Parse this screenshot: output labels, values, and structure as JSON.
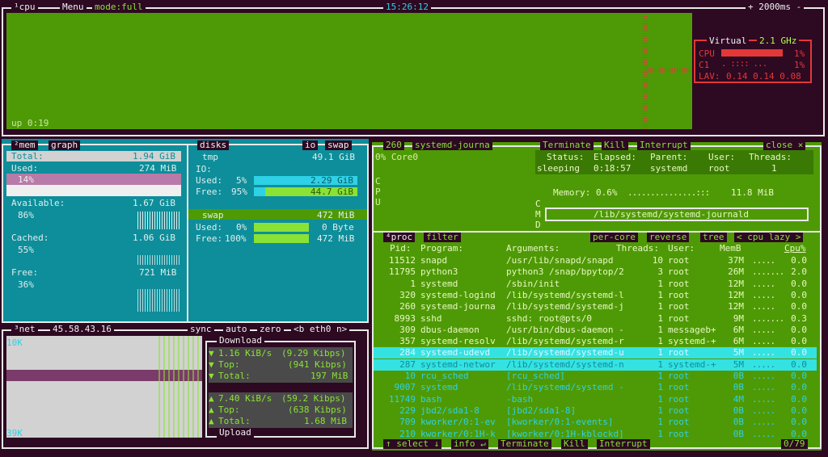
{
  "colors": {
    "bg": "#2d0922",
    "cpu_graph": "#4e9a06",
    "mem_panel": "#0e8e9a",
    "proc_panel": "#4e9a06",
    "selected_row": "#34e2e2",
    "accent": "#8ae234"
  },
  "cpu": {
    "tab": "¹cpu",
    "menu": "Menu",
    "mode": "mode:full",
    "clock": "15:26:12",
    "rate": "+ 2000ms -",
    "uptime": "up 0:19",
    "box_title": "Virtual",
    "freq": "2.1 GHz",
    "rows": [
      {
        "label": "CPU",
        "pct": "1%",
        "value": 0.01
      },
      {
        "label": "C1",
        "pct": "1%",
        "value": 0.01
      }
    ],
    "lav_label": "LAV:",
    "lav": "0.14 0.14 0.08"
  },
  "mem": {
    "tab": "²mem",
    "graph": "graph",
    "total_label": "Total:",
    "total": "1.94 GiB",
    "used_label": "Used:",
    "used": "274 MiB",
    "used_pct": "14%",
    "used_value": 0.14,
    "available_label": "Available:",
    "available": "1.67 GiB",
    "available_pct": "86%",
    "cached_label": "Cached:",
    "cached": "1.06 GiB",
    "cached_pct": "55%",
    "free_label": "Free:",
    "free": "721 MiB",
    "free_pct": "36%"
  },
  "disks": {
    "tab": "disks",
    "io": "io",
    "swap_tab": "swap",
    "tmp": {
      "name": "tmp",
      "size": "49.1 GiB",
      "io": "IO:",
      "used_label": "Used:",
      "used_pct": "5%",
      "used": "2.29 GiB",
      "used_value": 0.05,
      "free_label": "Free:",
      "free_pct": "95%",
      "free": "44.7 GiB",
      "free_value": 0.95
    },
    "swap": {
      "name": "swap",
      "size": "472 MiB",
      "used_label": "Used:",
      "used_pct": "0%",
      "used": "0 Byte",
      "used_value": 0.0,
      "free_label": "Free:",
      "free_pct": "100%",
      "free": "472 MiB",
      "free_value": 1.0
    }
  },
  "net": {
    "tab": "³net",
    "ip": "45.58.43.16",
    "sync": "sync",
    "auto": "auto",
    "zero": "zero",
    "iface": "<b eth0 n>",
    "scale_top": "10K",
    "scale_bottom": "39K",
    "download_title": "Download",
    "upload_title": "Upload",
    "download": [
      {
        "label": "1.16 KiB/s",
        "extra": "(9.29 Kibps)"
      },
      {
        "label": "Top:",
        "extra": "(941 Kibps)"
      },
      {
        "label": "Total:",
        "extra": "197 MiB"
      }
    ],
    "upload": [
      {
        "label": "7.40 KiB/s",
        "extra": "(59.2 Kibps)"
      },
      {
        "label": "Top:",
        "extra": "(638 Kibps)"
      },
      {
        "label": "Total:",
        "extra": "1.68 MiB"
      }
    ]
  },
  "detail": {
    "pid": "260",
    "name": "systemd-journa",
    "terminate": "Terminate",
    "kill": "Kill",
    "interrupt": "Interrupt",
    "close": "close ×",
    "core": "0% Core0",
    "status_h": "Status:",
    "elapsed_h": "Elapsed:",
    "parent_h": "Parent:",
    "user_h": "User:",
    "threads_h": "Threads:",
    "status": "sleeping",
    "elapsed": "0:18:57",
    "parent": "systemd",
    "user": "root",
    "threads": "1",
    "memory": "Memory: 0.6%",
    "memory_size": "11.8 MiB",
    "cmd": "/lib/systemd/systemd-journald",
    "side_cpu": "C\nP\nU",
    "side_cmd": "C\nM\nD"
  },
  "proc": {
    "tab": "⁴proc",
    "filter": "filter",
    "per_core": "per-core",
    "reverse": "reverse",
    "tree": "tree",
    "sort": "< cpu lazy >",
    "headers": {
      "pid": "Pid:",
      "program": "Program:",
      "args": "Arguments:",
      "threads": "Threads:",
      "user": "User:",
      "memb": "MemB",
      "cpu": "Cpu%"
    },
    "rows": [
      {
        "pid": "11512",
        "program": "snapd",
        "args": "/usr/lib/snapd/snapd",
        "threads": "10",
        "user": "root",
        "mem": "37M",
        "cpu": "0.0"
      },
      {
        "pid": "11795",
        "program": "python3",
        "args": "python3 /snap/bpytop/2",
        "threads": "3",
        "user": "root",
        "mem": "26M",
        "cpu": "2.0"
      },
      {
        "pid": "1",
        "program": "systemd",
        "args": "/sbin/init",
        "threads": "1",
        "user": "root",
        "mem": "12M",
        "cpu": "0.0"
      },
      {
        "pid": "320",
        "program": "systemd-logind",
        "args": "/lib/systemd/systemd-l",
        "threads": "1",
        "user": "root",
        "mem": "12M",
        "cpu": "0.0"
      },
      {
        "pid": "260",
        "program": "systemd-journa",
        "args": "/lib/systemd/systemd-j",
        "threads": "1",
        "user": "root",
        "mem": "12M",
        "cpu": "0.0"
      },
      {
        "pid": "8993",
        "program": "sshd",
        "args": "sshd: root@pts/0",
        "threads": "1",
        "user": "root",
        "mem": "9M",
        "cpu": "0.3"
      },
      {
        "pid": "309",
        "program": "dbus-daemon",
        "args": "/usr/bin/dbus-daemon -",
        "threads": "1",
        "user": "messageb+",
        "mem": "6M",
        "cpu": "0.0"
      },
      {
        "pid": "357",
        "program": "systemd-resolv",
        "args": "/lib/systemd/systemd-r",
        "threads": "1",
        "user": "systemd-+",
        "mem": "6M",
        "cpu": "0.0"
      },
      {
        "pid": "284",
        "program": "systemd-udevd",
        "args": "/lib/systemd/systemd-u",
        "threads": "1",
        "user": "root",
        "mem": "5M",
        "cpu": "0.0"
      },
      {
        "pid": "287",
        "program": "systemd-networ",
        "args": "/lib/systemd/systemd-n",
        "threads": "1",
        "user": "systemd-+",
        "mem": "5M",
        "cpu": "0.0"
      },
      {
        "pid": "10",
        "program": "rcu_sched",
        "args": "[rcu_sched]",
        "threads": "1",
        "user": "root",
        "mem": "0B",
        "cpu": "0.0"
      },
      {
        "pid": "9007",
        "program": "systemd",
        "args": "/lib/systemd/systemd -",
        "threads": "1",
        "user": "root",
        "mem": "0B",
        "cpu": "0.0"
      },
      {
        "pid": "11749",
        "program": "bash",
        "args": "-bash",
        "threads": "1",
        "user": "root",
        "mem": "4M",
        "cpu": "0.0"
      },
      {
        "pid": "229",
        "program": "jbd2/sda1-8",
        "args": "[jbd2/sda1-8]",
        "threads": "1",
        "user": "root",
        "mem": "0B",
        "cpu": "0.0"
      },
      {
        "pid": "709",
        "program": "kworker/0:1-ev",
        "args": "[kworker/0:1-events]",
        "threads": "1",
        "user": "root",
        "mem": "0B",
        "cpu": "0.0"
      },
      {
        "pid": "210",
        "program": "kworker/0:1H-k",
        "args": "[kworker/0:1H-kblockd]",
        "threads": "1",
        "user": "root",
        "mem": "0B",
        "cpu": "0.0"
      }
    ],
    "selected_index": 8,
    "footer": {
      "select": "↑ select ↓",
      "info": "info ↵",
      "terminate": "Terminate",
      "kill": "Kill",
      "interrupt": "Interrupt",
      "count": "0/79"
    }
  }
}
